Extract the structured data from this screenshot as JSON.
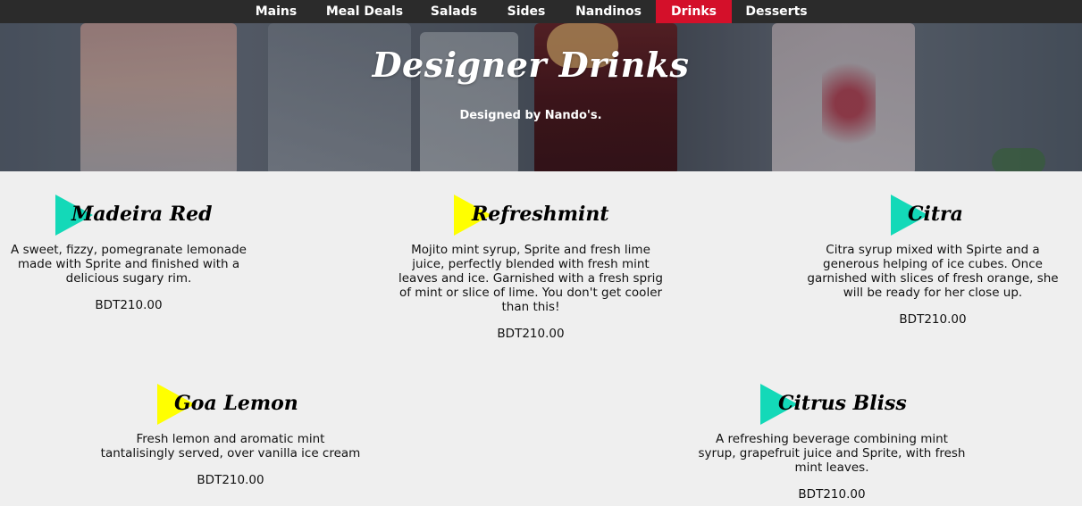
{
  "nav": {
    "items": [
      {
        "label": "Mains"
      },
      {
        "label": "Meal Deals"
      },
      {
        "label": "Salads"
      },
      {
        "label": "Sides"
      },
      {
        "label": "Nandinos"
      },
      {
        "label": "Drinks"
      },
      {
        "label": "Desserts"
      }
    ],
    "active": "Drinks"
  },
  "hero": {
    "title": "Designer Drinks",
    "subtitle": "Designed by Nando's."
  },
  "drinks": [
    {
      "name": "Madeira Red",
      "description": "A sweet, fizzy, pomegranate lemonade made with Sprite and finished with a delicious sugary rim.",
      "price": "BDT210.00",
      "accent": "#13d9b8"
    },
    {
      "name": "Refreshmint",
      "description": "Mojito mint syrup, Sprite and fresh lime juice, perfectly blended with fresh mint leaves and ice. Garnished with a fresh sprig of mint or slice of lime. You don't get cooler than this!",
      "price": "BDT210.00",
      "accent": "#ffff00"
    },
    {
      "name": "Citra",
      "description": "Citra syrup mixed with Spirte and a generous helping of ice cubes. Once garnished with slices of fresh orange, she will be ready for her close up.",
      "price": "BDT210.00",
      "accent": "#13d9b8"
    },
    {
      "name": "Goa Lemon",
      "description": "Fresh lemon and aromatic mint tantalisingly served, over vanilla ice cream",
      "price": "BDT210.00",
      "accent": "#ffff00"
    },
    {
      "name": "Citrus Bliss",
      "description": "A refreshing beverage combining mint syrup, grapefruit juice and Sprite, with fresh mint leaves.",
      "price": "BDT210.00",
      "accent": "#13d9b8"
    }
  ]
}
